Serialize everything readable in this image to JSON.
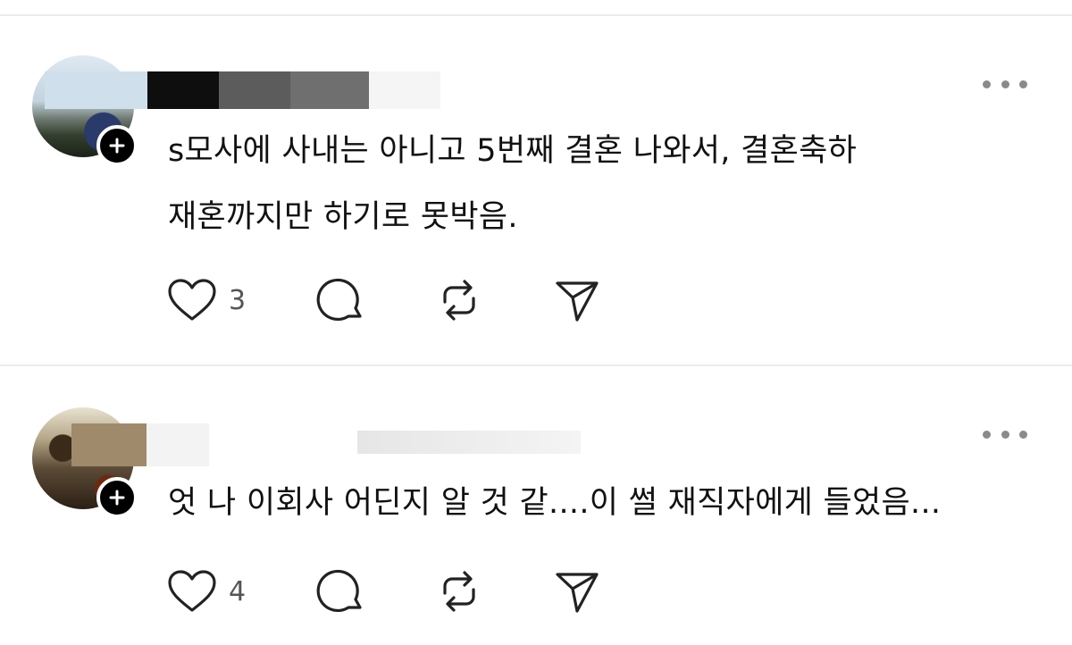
{
  "posts": [
    {
      "text": "s모사에 사내는 아니고 5번째 결혼 나와서, 결혼축하\n재혼까지만 하기로 못박음.",
      "like_count": "3",
      "icons": [
        "heart-icon",
        "comment-icon",
        "repost-icon",
        "share-icon",
        "more-icon",
        "plus-icon"
      ]
    },
    {
      "text": "엇 나 이회사 어딘지 알 것 같....이 썰 재직자에게 들었음...",
      "like_count": "4",
      "icons": [
        "heart-icon",
        "comment-icon",
        "repost-icon",
        "share-icon",
        "more-icon",
        "plus-icon"
      ]
    }
  ],
  "colors": {
    "text": "#111111",
    "muted": "#555555",
    "divider": "#ececec",
    "badge": "#000000"
  }
}
